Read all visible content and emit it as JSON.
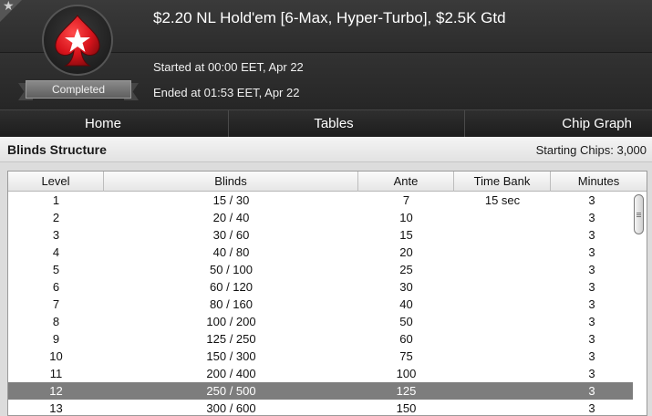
{
  "header": {
    "title": "$2.20 NL Hold'em [6-Max, Hyper-Turbo], $2.5K Gtd",
    "status": "Completed",
    "started": "Started at 00:00 EET, Apr 22",
    "ended": "Ended at 01:53 EET, Apr 22",
    "logo_icon": "spade-star-icon",
    "favorite_icon": "star-icon"
  },
  "tabs": [
    {
      "label": "Home"
    },
    {
      "label": "Tables"
    },
    {
      "label": "Chip Graph"
    }
  ],
  "section": {
    "title": "Blinds Structure",
    "starting_chips": "Starting Chips: 3,000"
  },
  "table": {
    "columns": [
      "Level",
      "Blinds",
      "Ante",
      "Time Bank",
      "Minutes"
    ],
    "rows": [
      {
        "level": "1",
        "blinds": "15 / 30",
        "ante": "7",
        "time_bank": "15 sec",
        "minutes": "3"
      },
      {
        "level": "2",
        "blinds": "20 / 40",
        "ante": "10",
        "time_bank": "",
        "minutes": "3"
      },
      {
        "level": "3",
        "blinds": "30 / 60",
        "ante": "15",
        "time_bank": "",
        "minutes": "3"
      },
      {
        "level": "4",
        "blinds": "40 / 80",
        "ante": "20",
        "time_bank": "",
        "minutes": "3"
      },
      {
        "level": "5",
        "blinds": "50 / 100",
        "ante": "25",
        "time_bank": "",
        "minutes": "3"
      },
      {
        "level": "6",
        "blinds": "60 / 120",
        "ante": "30",
        "time_bank": "",
        "minutes": "3"
      },
      {
        "level": "7",
        "blinds": "80 / 160",
        "ante": "40",
        "time_bank": "",
        "minutes": "3"
      },
      {
        "level": "8",
        "blinds": "100 / 200",
        "ante": "50",
        "time_bank": "",
        "minutes": "3"
      },
      {
        "level": "9",
        "blinds": "125 / 250",
        "ante": "60",
        "time_bank": "",
        "minutes": "3"
      },
      {
        "level": "10",
        "blinds": "150 / 300",
        "ante": "75",
        "time_bank": "",
        "minutes": "3"
      },
      {
        "level": "11",
        "blinds": "200 / 400",
        "ante": "100",
        "time_bank": "",
        "minutes": "3"
      },
      {
        "level": "12",
        "blinds": "250 / 500",
        "ante": "125",
        "time_bank": "",
        "minutes": "3"
      },
      {
        "level": "13",
        "blinds": "300 / 600",
        "ante": "150",
        "time_bank": "",
        "minutes": "3"
      }
    ],
    "selected_level": "12"
  },
  "colors": {
    "header_bg": "#2c2c2c",
    "selected_row": "#7d7d7d",
    "logo_red": "#d8141c"
  }
}
